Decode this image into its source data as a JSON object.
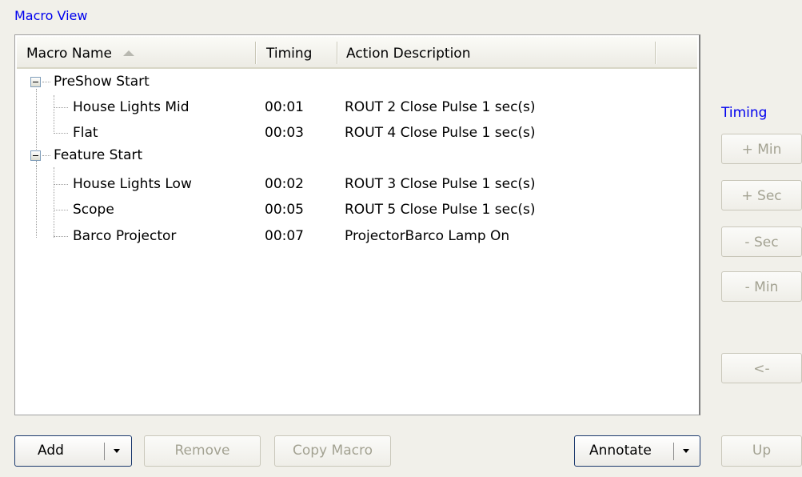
{
  "group_title": "Macro View",
  "columns": {
    "name": "Macro Name",
    "timing": "Timing",
    "action": "Action Description"
  },
  "groups": [
    {
      "label": "PreShow Start",
      "items": [
        {
          "name": "House Lights Mid",
          "timing": "00:01",
          "action": "ROUT 2 Close Pulse 1 sec(s)"
        },
        {
          "name": "Flat",
          "timing": "00:03",
          "action": "ROUT 4 Close Pulse 1 sec(s)"
        }
      ]
    },
    {
      "label": "Feature Start",
      "items": [
        {
          "name": "House Lights Low",
          "timing": "00:02",
          "action": "ROUT 3 Close Pulse 1 sec(s)"
        },
        {
          "name": "Scope",
          "timing": "00:05",
          "action": "ROUT 5 Close Pulse 1 sec(s)"
        },
        {
          "name": "Barco Projector",
          "timing": "00:07",
          "action": "ProjectorBarco Lamp On"
        }
      ]
    }
  ],
  "timing_panel": {
    "label": "Timing",
    "plus_min": "+ Min",
    "plus_sec": "+ Sec",
    "minus_sec": "- Sec",
    "minus_min": "- Min",
    "back": "<-"
  },
  "bottom_bar": {
    "add": "Add",
    "remove": "Remove",
    "copy_macro": "Copy Macro",
    "annotate": "Annotate",
    "up": "Up"
  },
  "colors": {
    "background": "#f1f0ea",
    "group_title": "#0000ee",
    "enabled_border": "#1c3a6e",
    "disabled_text": "#a3a292"
  }
}
